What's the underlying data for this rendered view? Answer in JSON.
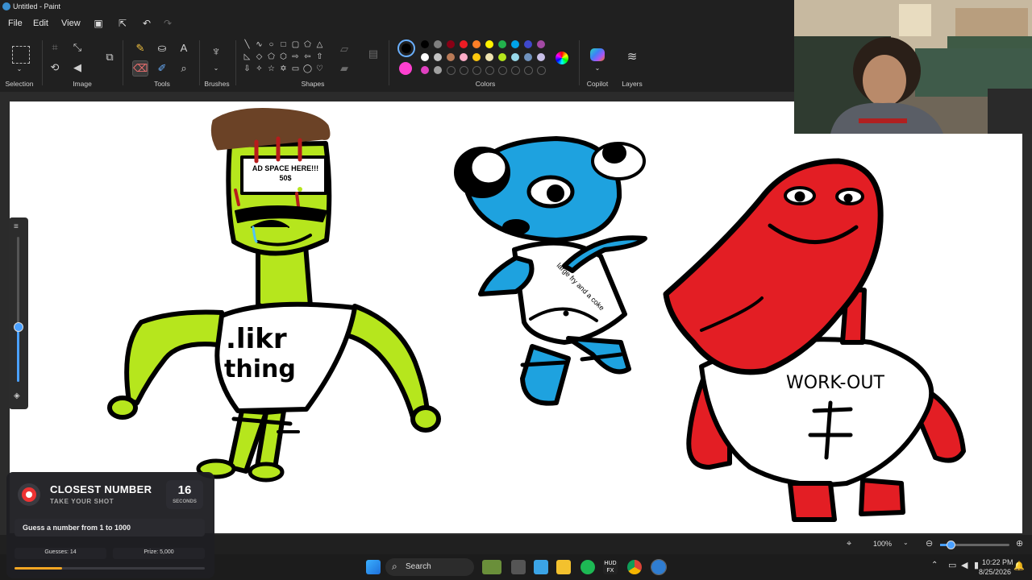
{
  "window": {
    "title": "Untitled - Paint"
  },
  "menu": {
    "file": "File",
    "edit": "Edit",
    "view": "View"
  },
  "quick_access": [
    "save-icon",
    "share-icon",
    "undo-icon",
    "redo-icon"
  ],
  "ribbon": {
    "selection": "Selection",
    "image": "Image",
    "tools": "Tools",
    "brushes": "Brushes",
    "shapes": "Shapes",
    "colors": "Colors",
    "copilot": "Copilot",
    "layers": "Layers"
  },
  "palette": {
    "row1": [
      "#000000",
      "#7f7f7f",
      "#880015",
      "#ed1c24",
      "#ff7f27",
      "#fff200",
      "#22b14c",
      "#00a2e8",
      "#3f48cc",
      "#a349a4"
    ],
    "row2": [
      "#ffffff",
      "#c3c3c3",
      "#b97a57",
      "#ffaec9",
      "#ffc90e",
      "#efe4b0",
      "#b5e61d",
      "#99d9ea",
      "#7092be",
      "#c8bfe7"
    ],
    "row3": [
      "#e040c0",
      "#a0a0a0"
    ],
    "primary": "#000000",
    "secondary": "#ff40d0"
  },
  "drawing": {
    "ad_line1": "AD SPACE HERE!!!",
    "ad_line2": "50$",
    "shirt1_line1": ".likr",
    "shirt1_line2": "thing",
    "shirt2_text": "large fry and a coke",
    "shirt3_text": "WORK-OUT"
  },
  "overlay": {
    "title": "CLOSEST NUMBER",
    "subtitle": "TAKE YOUR SHOT",
    "seconds_value": "16",
    "seconds_label": "SECONDS",
    "prompt": "Guess a number from 1 to 1000",
    "guesses": "Guesses: 14",
    "prize": "Prize: 5,000",
    "progress": 0.25
  },
  "statusbar": {
    "zoom": "100%"
  },
  "taskbar": {
    "search": "Search",
    "apps": [
      "start",
      "search",
      "file-explorer",
      "task-view",
      "notepad",
      "folder",
      "spotify",
      "hud",
      "chrome",
      "paint"
    ],
    "time": "10:22 PM",
    "date": "8/25/2026"
  }
}
